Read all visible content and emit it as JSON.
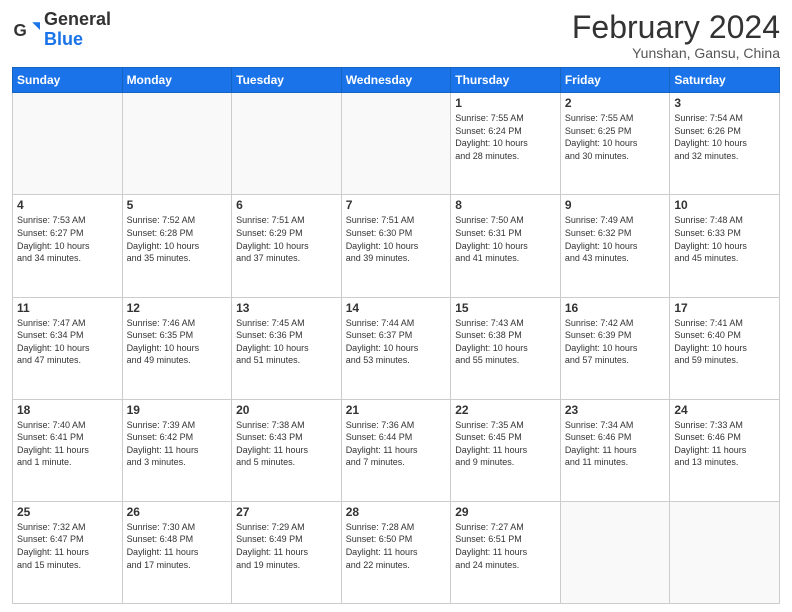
{
  "header": {
    "logo_general": "General",
    "logo_blue": "Blue",
    "month_year": "February 2024",
    "location": "Yunshan, Gansu, China"
  },
  "weekdays": [
    "Sunday",
    "Monday",
    "Tuesday",
    "Wednesday",
    "Thursday",
    "Friday",
    "Saturday"
  ],
  "weeks": [
    [
      {
        "day": "",
        "info": ""
      },
      {
        "day": "",
        "info": ""
      },
      {
        "day": "",
        "info": ""
      },
      {
        "day": "",
        "info": ""
      },
      {
        "day": "1",
        "info": "Sunrise: 7:55 AM\nSunset: 6:24 PM\nDaylight: 10 hours\nand 28 minutes."
      },
      {
        "day": "2",
        "info": "Sunrise: 7:55 AM\nSunset: 6:25 PM\nDaylight: 10 hours\nand 30 minutes."
      },
      {
        "day": "3",
        "info": "Sunrise: 7:54 AM\nSunset: 6:26 PM\nDaylight: 10 hours\nand 32 minutes."
      }
    ],
    [
      {
        "day": "4",
        "info": "Sunrise: 7:53 AM\nSunset: 6:27 PM\nDaylight: 10 hours\nand 34 minutes."
      },
      {
        "day": "5",
        "info": "Sunrise: 7:52 AM\nSunset: 6:28 PM\nDaylight: 10 hours\nand 35 minutes."
      },
      {
        "day": "6",
        "info": "Sunrise: 7:51 AM\nSunset: 6:29 PM\nDaylight: 10 hours\nand 37 minutes."
      },
      {
        "day": "7",
        "info": "Sunrise: 7:51 AM\nSunset: 6:30 PM\nDaylight: 10 hours\nand 39 minutes."
      },
      {
        "day": "8",
        "info": "Sunrise: 7:50 AM\nSunset: 6:31 PM\nDaylight: 10 hours\nand 41 minutes."
      },
      {
        "day": "9",
        "info": "Sunrise: 7:49 AM\nSunset: 6:32 PM\nDaylight: 10 hours\nand 43 minutes."
      },
      {
        "day": "10",
        "info": "Sunrise: 7:48 AM\nSunset: 6:33 PM\nDaylight: 10 hours\nand 45 minutes."
      }
    ],
    [
      {
        "day": "11",
        "info": "Sunrise: 7:47 AM\nSunset: 6:34 PM\nDaylight: 10 hours\nand 47 minutes."
      },
      {
        "day": "12",
        "info": "Sunrise: 7:46 AM\nSunset: 6:35 PM\nDaylight: 10 hours\nand 49 minutes."
      },
      {
        "day": "13",
        "info": "Sunrise: 7:45 AM\nSunset: 6:36 PM\nDaylight: 10 hours\nand 51 minutes."
      },
      {
        "day": "14",
        "info": "Sunrise: 7:44 AM\nSunset: 6:37 PM\nDaylight: 10 hours\nand 53 minutes."
      },
      {
        "day": "15",
        "info": "Sunrise: 7:43 AM\nSunset: 6:38 PM\nDaylight: 10 hours\nand 55 minutes."
      },
      {
        "day": "16",
        "info": "Sunrise: 7:42 AM\nSunset: 6:39 PM\nDaylight: 10 hours\nand 57 minutes."
      },
      {
        "day": "17",
        "info": "Sunrise: 7:41 AM\nSunset: 6:40 PM\nDaylight: 10 hours\nand 59 minutes."
      }
    ],
    [
      {
        "day": "18",
        "info": "Sunrise: 7:40 AM\nSunset: 6:41 PM\nDaylight: 11 hours\nand 1 minute."
      },
      {
        "day": "19",
        "info": "Sunrise: 7:39 AM\nSunset: 6:42 PM\nDaylight: 11 hours\nand 3 minutes."
      },
      {
        "day": "20",
        "info": "Sunrise: 7:38 AM\nSunset: 6:43 PM\nDaylight: 11 hours\nand 5 minutes."
      },
      {
        "day": "21",
        "info": "Sunrise: 7:36 AM\nSunset: 6:44 PM\nDaylight: 11 hours\nand 7 minutes."
      },
      {
        "day": "22",
        "info": "Sunrise: 7:35 AM\nSunset: 6:45 PM\nDaylight: 11 hours\nand 9 minutes."
      },
      {
        "day": "23",
        "info": "Sunrise: 7:34 AM\nSunset: 6:46 PM\nDaylight: 11 hours\nand 11 minutes."
      },
      {
        "day": "24",
        "info": "Sunrise: 7:33 AM\nSunset: 6:46 PM\nDaylight: 11 hours\nand 13 minutes."
      }
    ],
    [
      {
        "day": "25",
        "info": "Sunrise: 7:32 AM\nSunset: 6:47 PM\nDaylight: 11 hours\nand 15 minutes."
      },
      {
        "day": "26",
        "info": "Sunrise: 7:30 AM\nSunset: 6:48 PM\nDaylight: 11 hours\nand 17 minutes."
      },
      {
        "day": "27",
        "info": "Sunrise: 7:29 AM\nSunset: 6:49 PM\nDaylight: 11 hours\nand 19 minutes."
      },
      {
        "day": "28",
        "info": "Sunrise: 7:28 AM\nSunset: 6:50 PM\nDaylight: 11 hours\nand 22 minutes."
      },
      {
        "day": "29",
        "info": "Sunrise: 7:27 AM\nSunset: 6:51 PM\nDaylight: 11 hours\nand 24 minutes."
      },
      {
        "day": "",
        "info": ""
      },
      {
        "day": "",
        "info": ""
      }
    ]
  ]
}
